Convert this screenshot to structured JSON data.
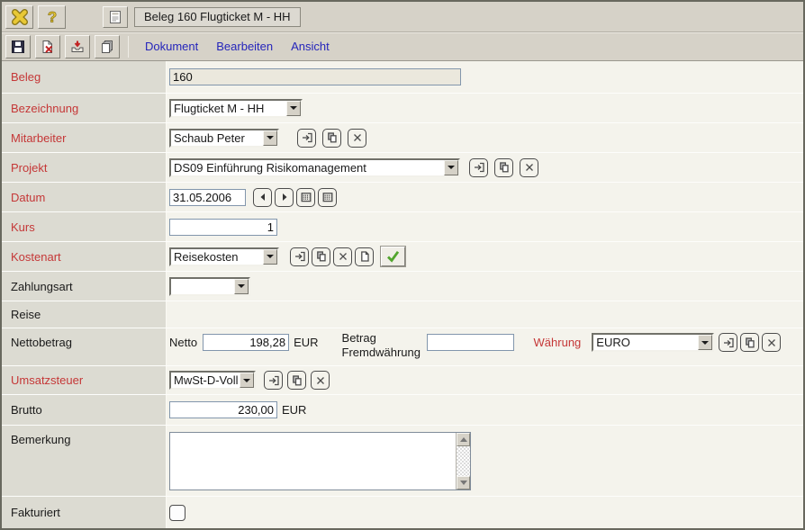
{
  "window_title": "Beleg 160 Flugticket M - HH",
  "toolbar_icons": {
    "close": "gold-x-mark",
    "help": "gold-question-mark",
    "form": "document-window",
    "save": "floppy-disk",
    "delete": "document-with-red-x",
    "import": "tray-with-red-arrow",
    "copy": "document-stack"
  },
  "menu": {
    "dokument": "Dokument",
    "bearbeiten": "Bearbeiten",
    "ansicht": "Ansicht"
  },
  "fields": {
    "beleg": {
      "label": "Beleg",
      "value": "160"
    },
    "bezeichnung": {
      "label": "Bezeichnung",
      "value": "Flugticket M - HH"
    },
    "mitarbeiter": {
      "label": "Mitarbeiter",
      "value": "Schaub Peter"
    },
    "projekt": {
      "label": "Projekt",
      "value": "DS09 Einführung Risikomanagement"
    },
    "datum": {
      "label": "Datum",
      "value": "31.05.2006"
    },
    "kurs": {
      "label": "Kurs",
      "value": "1"
    },
    "kostenart": {
      "label": "Kostenart",
      "value": "Reisekosten"
    },
    "zahlungsart": {
      "label": "Zahlungsart",
      "value": ""
    },
    "reise": {
      "label": "Reise"
    },
    "nettobetrag": {
      "label": "Nettobetrag",
      "netto_label": "Netto",
      "netto_value": "198,28",
      "netto_unit": "EUR",
      "fremdwaehrung_label": "Betrag Fremdwährung",
      "fremdwaehrung_value": "",
      "waehrung_label": "Währung",
      "waehrung_value": "EURO"
    },
    "umsatzsteuer": {
      "label": "Umsatzsteuer",
      "value": "MwSt-D-Voll"
    },
    "brutto": {
      "label": "Brutto",
      "value": "230,00",
      "unit": "EUR"
    },
    "bemerkung": {
      "label": "Bemerkung",
      "value": ""
    },
    "fakturiert": {
      "label": "Fakturiert",
      "checked": false
    }
  },
  "colors": {
    "label_red": "#c53737",
    "menu_blue": "#2525bb",
    "check_green": "#52a52e",
    "icon_gold": "#e8c835",
    "label_column_bg": "#dcdbd2",
    "content_bg": "#f4f3ec",
    "toolbar_bg": "#d6d2c8",
    "readonly_bg": "#ebe8dd"
  }
}
